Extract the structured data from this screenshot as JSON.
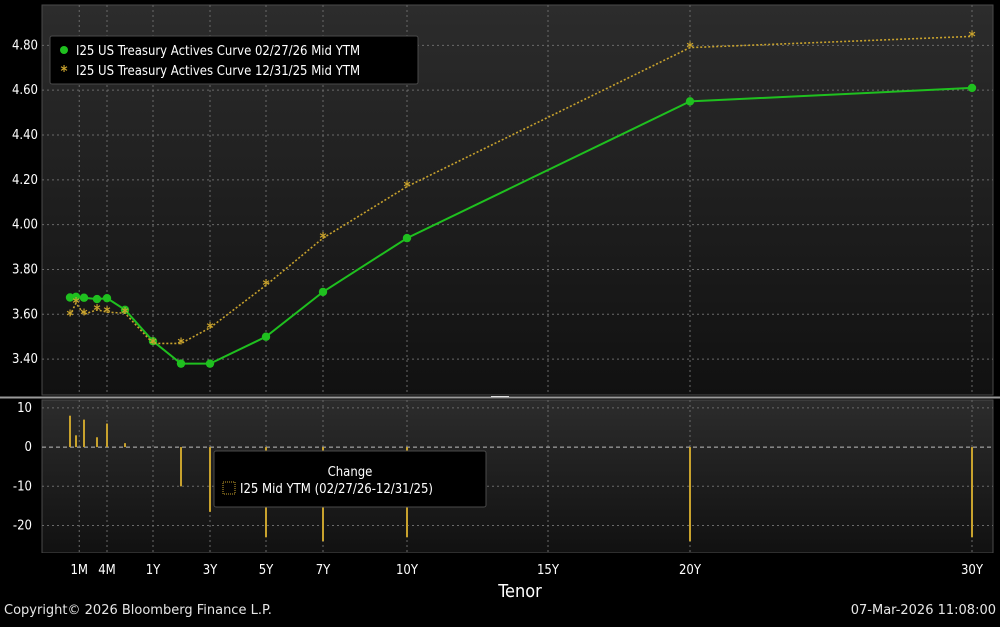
{
  "chart_data": [
    {
      "type": "line",
      "xlabel": "Tenor",
      "x_axis_tenors_years": [
        0.0833,
        0.1667,
        0.25,
        0.3333,
        0.5,
        0.6667,
        1,
        2,
        3,
        5,
        7,
        10,
        20,
        30
      ],
      "x_tick_labels": [
        {
          "label": "1M",
          "t": 0.0833
        },
        {
          "label": "4M",
          "t": 0.3333
        },
        {
          "label": "1Y",
          "t": 1
        },
        {
          "label": "3Y",
          "t": 2
        },
        {
          "label": "5Y",
          "t": 3
        },
        {
          "label": "7Y",
          "t": 4
        },
        {
          "label": "10Y",
          "t": 5
        },
        {
          "label": "15Y",
          "t": 6.5
        },
        {
          "label": "20Y",
          "t": 8
        },
        {
          "label": "30Y",
          "t": 10
        }
      ],
      "y_ticks": [
        "4.80",
        "4.60",
        "4.40",
        "4.20",
        "4.00",
        "3.80",
        "3.60",
        "3.40"
      ],
      "ylim": [
        3.24,
        4.98
      ],
      "grid": true,
      "legend_position": "top-left",
      "series": [
        {
          "name": "I25 US Treasury Actives Curve 02/27/26 Mid YTM",
          "color": "#1fc01f",
          "marker": "circle",
          "t": [
            0,
            0.15,
            0.32,
            0.55,
            0.75,
            1.3,
            1.75,
            2,
            3,
            4,
            5,
            8,
            10
          ],
          "values": [
            3.675,
            3.678,
            3.674,
            3.668,
            3.672,
            3.62,
            3.48,
            3.38,
            3.38,
            3.5,
            3.7,
            3.94,
            4.55,
            4.61
          ]
        },
        {
          "name": "I25 US Treasury Actives Curve 12/31/25 Mid YTM",
          "color": "#c8a22d",
          "marker": "asterisk",
          "t": [
            0,
            0.15,
            0.32,
            0.55,
            0.75,
            1.3,
            1.75,
            2,
            3,
            4,
            5,
            8,
            10
          ],
          "values": [
            3.595,
            3.65,
            3.6,
            3.62,
            3.61,
            3.605,
            3.47,
            3.47,
            3.54,
            3.73,
            3.94,
            4.17,
            4.79,
            4.84
          ]
        }
      ]
    },
    {
      "type": "bar",
      "legend_title": "Change",
      "legend_label": "I25 Mid YTM (02/27/26-12/31/25)",
      "color": "#c8a22d",
      "y_ticks": [
        "10",
        "0",
        "-10",
        "-20"
      ],
      "ylim": [
        -27,
        12
      ],
      "t": [
        0,
        0.15,
        0.32,
        0.55,
        0.75,
        1.3,
        2.45,
        3,
        4,
        5,
        8,
        10
      ],
      "values": [
        8,
        3,
        7,
        2.5,
        6,
        1,
        -10,
        -16.5,
        -23,
        -24,
        -23,
        -24,
        -23
      ]
    }
  ],
  "footer": {
    "copyright": "Copyright© 2026 Bloomberg Finance L.P.",
    "timestamp": "07-Mar-2026 11:08:00"
  }
}
